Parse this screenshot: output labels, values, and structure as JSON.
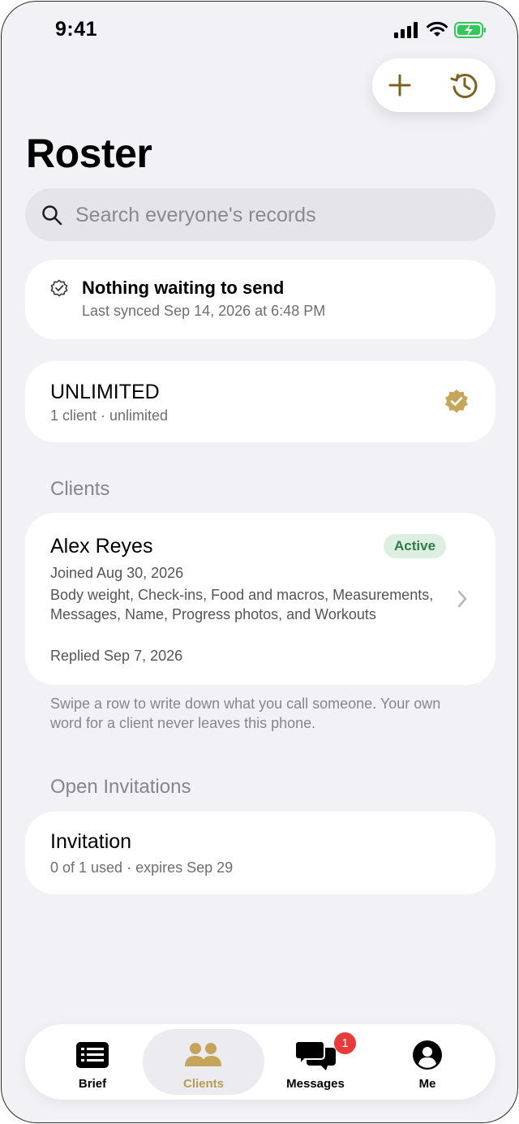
{
  "status_bar": {
    "time": "9:41"
  },
  "page": {
    "title": "Roster"
  },
  "search": {
    "placeholder": "Search everyone's records"
  },
  "sync": {
    "title": "Nothing waiting to send",
    "subtitle": "Last synced Sep 14, 2026 at 6:48 PM"
  },
  "plan": {
    "name": "UNLIMITED",
    "detail": "1 client · unlimited"
  },
  "clients": {
    "heading": "Clients",
    "items": [
      {
        "name": "Alex Reyes",
        "status": "Active",
        "joined": "Joined Aug 30, 2026",
        "shares": "Body weight, Check-ins, Food and macros, Measurements, Messages, Name, Progress photos, and Workouts",
        "replied": "Replied Sep 7, 2026"
      }
    ],
    "footnote": "Swipe a row to write down what you call someone. Your own word for a client never leaves this phone."
  },
  "invitations": {
    "heading": "Open Invitations",
    "items": [
      {
        "title": "Invitation",
        "detail": "0 of 1 used · expires Sep 29"
      }
    ]
  },
  "tabs": [
    {
      "label": "Brief",
      "icon": "newspaper-icon"
    },
    {
      "label": "Clients",
      "icon": "people-icon",
      "active": true
    },
    {
      "label": "Messages",
      "icon": "chat-bubbles-icon",
      "badge": "1"
    },
    {
      "label": "Me",
      "icon": "person-circle-icon"
    }
  ],
  "colors": {
    "accent": "#b89a52",
    "background": "#f2f1f6",
    "active_badge_bg": "#dcefe0",
    "active_badge_text": "#2e7d44",
    "notification": "#ea3b3b"
  }
}
